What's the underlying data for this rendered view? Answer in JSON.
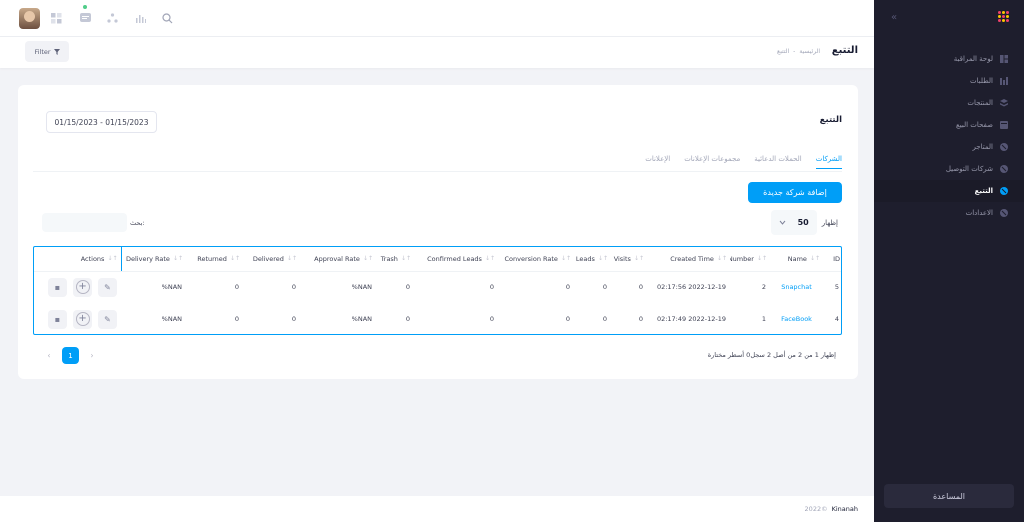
{
  "colors": {
    "accent": "#009ef7",
    "sidebar_bg": "#1e1e2d",
    "online_dot": "#50cd89"
  },
  "topbar": {
    "icons": [
      "avatar",
      "grid-icon",
      "chat-icon",
      "network-icon",
      "chart-icon",
      "search-icon"
    ]
  },
  "subbar": {
    "filter_label": "Filter",
    "page_title": "التتبع",
    "breadcrumb": [
      "الرئيسية",
      "التتبع"
    ]
  },
  "card": {
    "title": "التتبع",
    "date_range": "01/15/2023 - 01/15/2023",
    "tabs": [
      "الشركات",
      "الحملات الدعائية",
      "مجموعات الإعلانات",
      "الإعلانات"
    ],
    "active_tab": "الشركات",
    "add_button": "إضافة شركة جديدة",
    "show_label": "إظهار",
    "show_value": "50",
    "search_label": "بحث:",
    "search_placeholder": ""
  },
  "table": {
    "columns": [
      "ID",
      "Name",
      "Number",
      "Created Time",
      "Visits",
      "Leads",
      "Conversion Rate",
      "Confirmed Leads",
      "Trash",
      "Approval Rate",
      "Delivered",
      "Returned",
      "Delivery Rate",
      "Actions"
    ],
    "rows": [
      {
        "id": "5",
        "name": "Snapchat",
        "number": "2",
        "created": "2022-12-19 02:17:56",
        "visits": "0",
        "leads": "0",
        "conversion": "0",
        "confirmed": "0",
        "trash": "0",
        "approval": "NAN%",
        "delivered": "0",
        "returned": "0",
        "delivery": "NAN%"
      },
      {
        "id": "4",
        "name": "FaceBook",
        "number": "1",
        "created": "2022-12-19 02:17:49",
        "visits": "0",
        "leads": "0",
        "conversion": "0",
        "confirmed": "0",
        "trash": "0",
        "approval": "NAN%",
        "delivered": "0",
        "returned": "0",
        "delivery": "NAN%"
      }
    ]
  },
  "pager": {
    "current": "1",
    "prev": "‹",
    "next": "›",
    "info": "إظهار 1 من 2 من أصل 2 سجل0 أسطر مختارة"
  },
  "footer": {
    "year": "2022©",
    "brand": "Kinanah"
  },
  "sidebar": {
    "items": [
      {
        "label": "لوحة المراقبة",
        "icon": "dashboard-icon"
      },
      {
        "label": "الطلبات",
        "icon": "orders-icon"
      },
      {
        "label": "المنتجات",
        "icon": "products-icon"
      },
      {
        "label": "صفحات البيع",
        "icon": "pages-icon"
      },
      {
        "label": "المتاجر",
        "icon": "store-icon"
      },
      {
        "label": "شركات التوصيل",
        "icon": "delivery-icon"
      },
      {
        "label": "التتبع",
        "icon": "tracking-icon",
        "active": true
      },
      {
        "label": "الاعدادات",
        "icon": "settings-icon"
      }
    ],
    "help": "المساعدة"
  }
}
